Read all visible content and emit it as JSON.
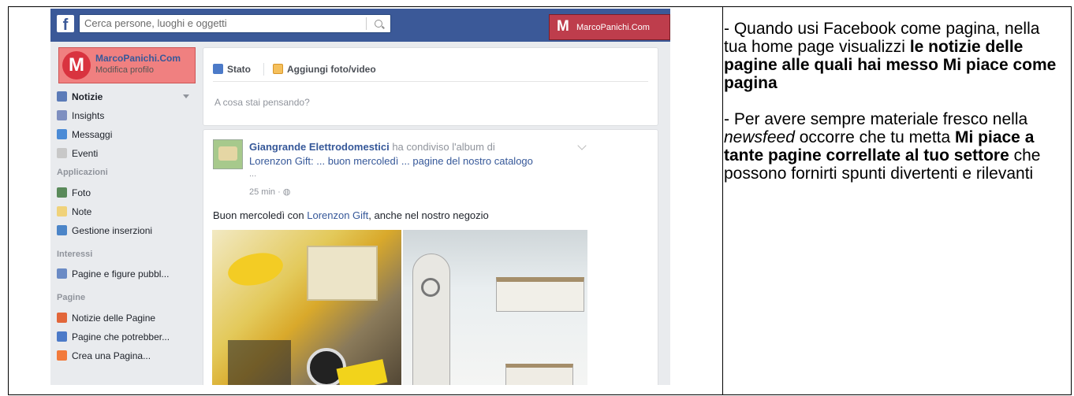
{
  "facebook": {
    "search_placeholder": "Cerca persone, luoghi e oggetti",
    "page_button_label": "MarcoPanichi.Com",
    "page_button_logo": "M",
    "logo_letter": "f",
    "profile": {
      "name": "MarcoPanichi.Com",
      "edit_label": "Modifica profilo",
      "avatar_letter": "M"
    },
    "nav": {
      "items_main": [
        {
          "label": "Notizie",
          "icon": "news-icon",
          "color": "#5b7bb8"
        },
        {
          "label": "Insights",
          "icon": "insights-icon",
          "color": "#7e8fc0"
        },
        {
          "label": "Messaggi",
          "icon": "messages-icon",
          "color": "#4b8bd6"
        },
        {
          "label": "Eventi",
          "icon": "calendar-icon",
          "color": "#c8c8c8"
        }
      ],
      "apps_header": "Applicazioni",
      "items_apps": [
        {
          "label": "Foto",
          "icon": "photos-icon",
          "color": "#5a8a5a"
        },
        {
          "label": "Note",
          "icon": "notes-icon",
          "color": "#f0d27a"
        },
        {
          "label": "Gestione inserzioni",
          "icon": "ads-manager-icon",
          "color": "#4c85c8"
        }
      ],
      "interests_header": "Interessi",
      "items_interests": [
        {
          "label": "Pagine e figure pubbl...",
          "icon": "feed-icon",
          "color": "#6b8bc5"
        }
      ],
      "pages_header": "Pagine",
      "items_pages": [
        {
          "label": "Notizie delle Pagine",
          "icon": "megaphone-icon",
          "color": "#e2663a"
        },
        {
          "label": "Pagine che potrebber...",
          "icon": "like-icon",
          "color": "#4c7ac8"
        },
        {
          "label": "Crea una Pagina...",
          "icon": "create-page-icon",
          "color": "#f27a3b"
        }
      ]
    },
    "composer": {
      "tab_status": "Stato",
      "tab_photo": "Aggiungi foto/video",
      "placeholder": "A cosa stai pensando?"
    },
    "post": {
      "author": "Giangrande Elettrodomestici",
      "action": " ha condiviso l'album di",
      "line2": "Lorenzon Gift:  ... buon mercoledì ... pagine del nostro catalogo",
      "ellipsis": "...",
      "time": "25 min · ◍",
      "text_before": "Buon mercoledì con ",
      "text_link": "Lorenzon Gift",
      "text_after": ", anche nel nostro negozio"
    }
  },
  "right_panel": {
    "p1_prefix": "- Quando usi Facebook come pagina, nella tua home page visualizzi ",
    "p1_bold": "le notizie delle pagine alle quali hai messo Mi piace come pagina",
    "p2_prefix": "- Per avere sempre materiale fresco nella ",
    "p2_italic": "newsfeed",
    "p2_mid": " occorre che tu metta ",
    "p2_bold": "Mi piace a tante pagine correllate al tuo settore",
    "p2_suffix": " che possono fornirti spunti divertenti e rilevanti"
  }
}
